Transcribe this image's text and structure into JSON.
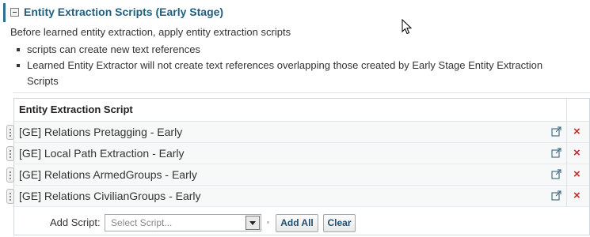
{
  "section": {
    "title": "Entity Extraction Scripts (Early Stage)",
    "description": "Before learned entity extraction, apply entity extraction scripts",
    "bullets": [
      "scripts can create new text references",
      "Learned Entity Extractor will not create text references overlapping those created by Early Stage Entity Extraction Scripts"
    ]
  },
  "table": {
    "column_header": "Entity Extraction Script",
    "rows": [
      {
        "name": "[GE] Relations Pretagging - Early",
        "delete": "×"
      },
      {
        "name": "[GE] Local Path Extraction - Early",
        "delete": "×"
      },
      {
        "name": "[GE] Relations ArmedGroups - Early",
        "delete": "×"
      },
      {
        "name": "[GE] Relations CivilianGroups - Early",
        "delete": "×"
      }
    ]
  },
  "add_bar": {
    "label": "Add Script:",
    "select_placeholder": "Select Script...",
    "add_all_label": "Add All",
    "clear_label": "Clear"
  },
  "icons": {
    "collapse": "minus-box-icon",
    "drag": "drag-handle-icon",
    "open_external": "external-link-icon",
    "delete": "delete-x-icon",
    "dropdown": "chevron-down-icon",
    "cursor": "mouse-pointer-icon"
  },
  "colors": {
    "title": "#1f5f7f",
    "accent_border": "#2e6e8e",
    "delete": "#cc2a2a"
  }
}
